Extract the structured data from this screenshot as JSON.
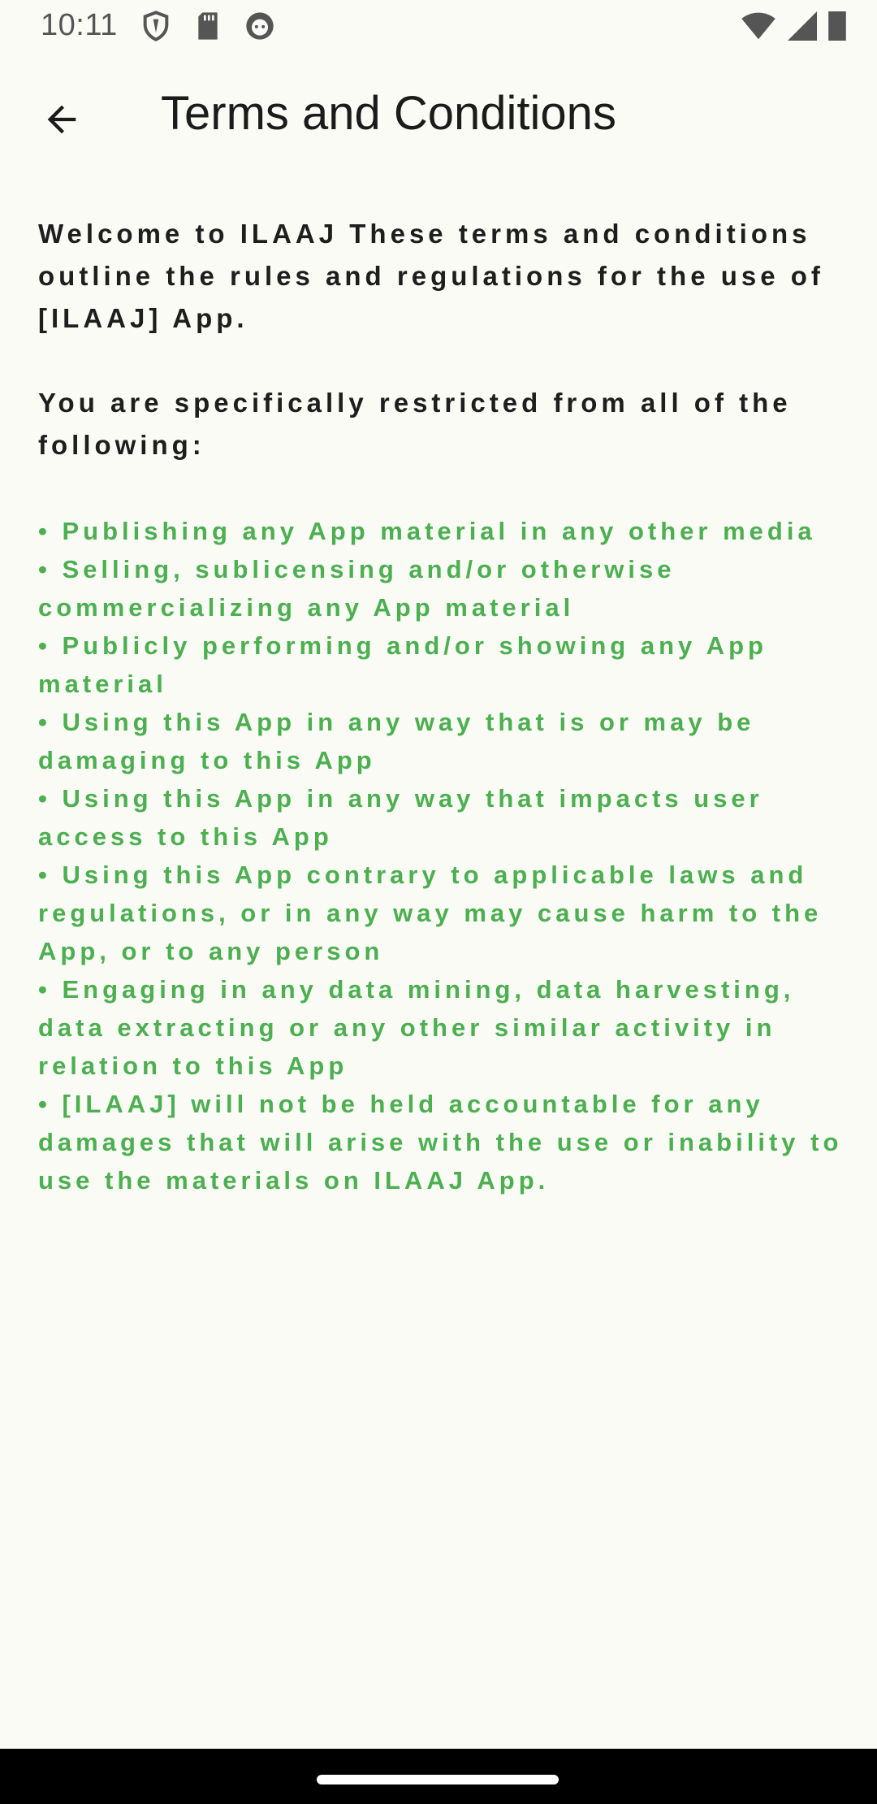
{
  "status_bar": {
    "time": "10:11",
    "left_icons": [
      "shield-icon",
      "sd-card-icon",
      "android-icon"
    ],
    "right_icons": [
      "wifi-icon",
      "cell-signal-icon",
      "battery-icon"
    ]
  },
  "app_bar": {
    "back_icon": "arrow-left-icon",
    "title": "Terms and Conditions"
  },
  "content": {
    "intro": "Welcome to ILAAJ These terms and conditions outline the rules and regulations for the use of [ILAAJ] App.",
    "restriction_heading": "You are specifically restricted from all of the following:",
    "bullets": [
      "• Publishing any App material in any other media",
      "• Selling, sublicensing and/or otherwise commercializing any App material",
      "• Publicly performing and/or showing any App material",
      "• Using this App in any way that is or may be damaging to this App",
      "• Using this App in any way that impacts user access to this App",
      "• Using this App contrary to applicable laws and regulations, or in any way may cause harm to the App, or to any person",
      "• Engaging in any data mining, data harvesting, data extracting or any other similar activity in relation to this App",
      "• [ILAAJ] will not be held accountable for any damages that will arise with the use or inability to use the materials on ILAAJ App."
    ]
  },
  "colors": {
    "background": "#fbfbf6",
    "accent_green": "#4caf50",
    "text": "#1e1e1e"
  }
}
